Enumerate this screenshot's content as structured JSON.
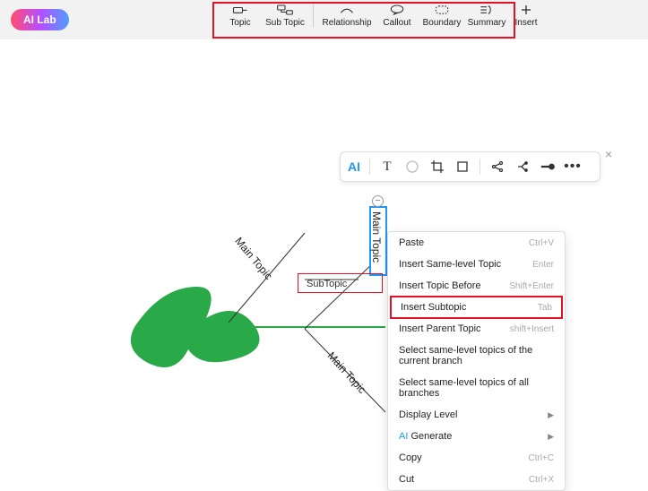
{
  "badge": "AI Lab",
  "toolbar": [
    {
      "label": "Topic"
    },
    {
      "label": "Sub Topic"
    },
    {
      "label": "Relationship"
    },
    {
      "label": "Callout"
    },
    {
      "label": "Boundary"
    },
    {
      "label": "Summary"
    },
    {
      "label": "Insert"
    }
  ],
  "float": {
    "ai": "AI",
    "t": "T"
  },
  "mm": {
    "main": "Main Topic",
    "sub": "SubTopic",
    "collapse": "−"
  },
  "ctx": [
    {
      "label": "Paste",
      "sc": "Ctrl+V"
    },
    {
      "label": "Insert Same-level Topic",
      "sc": "Enter"
    },
    {
      "label": "Insert Topic Before",
      "sc": "Shift+Enter"
    },
    {
      "label": "Insert Subtopic",
      "sc": "Tab",
      "hl": true
    },
    {
      "label": "Insert Parent Topic",
      "sc": "shift+Insert"
    },
    {
      "label": "Select same-level topics of the current branch"
    },
    {
      "label": "Select same-level topics of all branches"
    },
    {
      "label": "Display Level",
      "sub": true
    },
    {
      "label": "Generate",
      "sub": true,
      "ai": true
    },
    {
      "label": "Copy",
      "sc": "Ctrl+C"
    },
    {
      "label": "Cut",
      "sc": "Ctrl+X"
    }
  ]
}
